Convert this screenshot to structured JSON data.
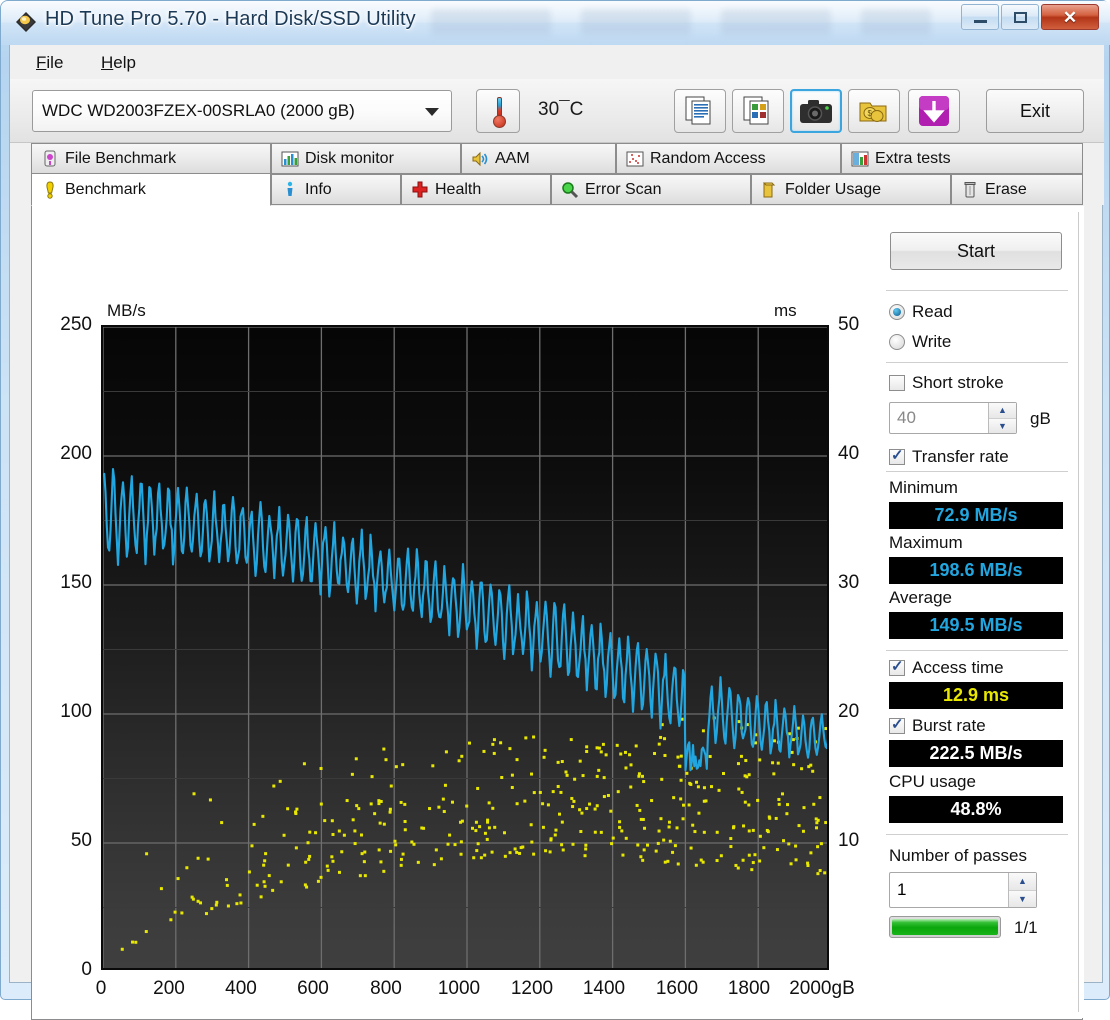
{
  "window": {
    "title": "HD Tune Pro 5.70 - Hard Disk/SSD Utility",
    "app_icon": "hdtune-diamond-icon",
    "minimize_label": "",
    "maximize_label": "",
    "close_label": "✕"
  },
  "menubar": {
    "items": [
      {
        "label": "File",
        "mnemonic": "F"
      },
      {
        "label": "Help",
        "mnemonic": "H"
      }
    ]
  },
  "toolbar": {
    "drive": {
      "selected": "WDC WD2003FZEX-00SRLA0 (2000 gB)",
      "options": [
        "WDC WD2003FZEX-00SRLA0 (2000 gB)"
      ]
    },
    "temperature": "30¯C",
    "temperature_icon": "thermometer-icon",
    "buttons": [
      {
        "name": "copy-text-button",
        "icon": "copy-text-icon",
        "focused": false
      },
      {
        "name": "copy-image-button",
        "icon": "copy-image-icon",
        "focused": false
      },
      {
        "name": "screenshot-button",
        "icon": "camera-icon",
        "focused": true
      },
      {
        "name": "save-button",
        "icon": "folder-coins-icon",
        "focused": false
      },
      {
        "name": "download-button",
        "icon": "purple-download-icon",
        "focused": false
      }
    ],
    "exit_label": "Exit"
  },
  "tabs": {
    "top_row": [
      {
        "label": "File Benchmark",
        "icon": "flask-icon",
        "active": false
      },
      {
        "label": "Disk monitor",
        "icon": "bar-chart-icon",
        "active": false
      },
      {
        "label": "AAM",
        "icon": "speaker-icon",
        "active": false
      },
      {
        "label": "Random Access",
        "icon": "scatter-icon",
        "active": false
      },
      {
        "label": "Extra tests",
        "icon": "chart-grid-icon",
        "active": false
      }
    ],
    "bottom_row": [
      {
        "label": "Benchmark",
        "icon": "exclamation-icon",
        "active": true
      },
      {
        "label": "Info",
        "icon": "info-icon",
        "active": false
      },
      {
        "label": "Health",
        "icon": "red-cross-icon",
        "active": false
      },
      {
        "label": "Error Scan",
        "icon": "magnifier-icon",
        "active": false
      },
      {
        "label": "Folder Usage",
        "icon": "folder-icon",
        "active": false
      },
      {
        "label": "Erase",
        "icon": "trash-icon",
        "active": false
      }
    ]
  },
  "panel": {
    "start_label": "Start",
    "mode": {
      "read_label": "Read",
      "write_label": "Write",
      "selected": "Read"
    },
    "short_stroke": {
      "label": "Short stroke",
      "checked": false,
      "value": "40",
      "unit": "gB"
    },
    "transfer_rate": {
      "label": "Transfer rate",
      "checked": true
    },
    "results": [
      {
        "label": "Minimum",
        "value": "72.9 MB/s",
        "color": "#22a6e0"
      },
      {
        "label": "Maximum",
        "value": "198.6 MB/s",
        "color": "#22a6e0"
      },
      {
        "label": "Average",
        "value": "149.5 MB/s",
        "color": "#22a6e0"
      }
    ],
    "access_time": {
      "label": "Access time",
      "checked": true,
      "value": "12.9 ms",
      "color": "#e8e800"
    },
    "burst_rate": {
      "label": "Burst rate",
      "checked": true,
      "value": "222.5 MB/s",
      "color": "#ffffff"
    },
    "cpu_usage": {
      "label": "CPU usage",
      "value": "48.8%",
      "color": "#ffffff"
    },
    "passes": {
      "label": "Number of passes",
      "value": "1"
    },
    "progress": {
      "percent": 100,
      "text": "1/1"
    }
  },
  "chart_data": {
    "type": "line",
    "title": "",
    "xlabel": "2000gB",
    "ylabel": "MB/s",
    "y2label": "ms",
    "xlim": [
      0,
      2000
    ],
    "ylim": [
      0,
      250
    ],
    "y2lim": [
      0,
      50
    ],
    "grid": true,
    "legend": "none",
    "xticks": [
      0,
      200,
      400,
      600,
      800,
      1000,
      1200,
      1400,
      1600,
      1800,
      2000
    ],
    "xtick_labels": [
      "0",
      "200",
      "400",
      "600",
      "800",
      "1000",
      "1200",
      "1400",
      "1600",
      "1800",
      "2000gB"
    ],
    "yticks": [
      0,
      50,
      100,
      150,
      200,
      250
    ],
    "ytick_labels": [
      "0",
      "50",
      "100",
      "150",
      "200",
      "250"
    ],
    "y2ticks": [
      10,
      20,
      30,
      40,
      50
    ],
    "y2tick_labels": [
      "10",
      "20",
      "30",
      "40",
      "50"
    ],
    "series": [
      {
        "name": "Transfer rate",
        "type": "line",
        "color": "#22a6e0",
        "axis": "left",
        "unit": "MB/s",
        "envelope_note": "dense sawtooth oscillation between a falling upper and lower bound",
        "upper": [
          [
            0,
            198.6
          ],
          [
            40,
            196
          ],
          [
            80,
            194
          ],
          [
            120,
            193
          ],
          [
            160,
            192
          ],
          [
            200,
            190
          ],
          [
            240,
            189
          ],
          [
            280,
            187
          ],
          [
            320,
            186
          ],
          [
            360,
            185
          ],
          [
            400,
            184
          ],
          [
            440,
            182
          ],
          [
            480,
            181
          ],
          [
            520,
            179
          ],
          [
            560,
            178
          ],
          [
            600,
            176
          ],
          [
            640,
            175
          ],
          [
            680,
            173
          ],
          [
            720,
            171
          ],
          [
            760,
            169
          ],
          [
            800,
            167
          ],
          [
            840,
            165
          ],
          [
            880,
            163
          ],
          [
            920,
            161
          ],
          [
            960,
            159
          ],
          [
            1000,
            157
          ],
          [
            1040,
            155
          ],
          [
            1080,
            153
          ],
          [
            1120,
            151
          ],
          [
            1160,
            149
          ],
          [
            1200,
            147
          ],
          [
            1240,
            145
          ],
          [
            1280,
            142
          ],
          [
            1320,
            140
          ],
          [
            1360,
            137
          ],
          [
            1400,
            135
          ],
          [
            1440,
            132
          ],
          [
            1480,
            129
          ],
          [
            1520,
            127
          ],
          [
            1560,
            124
          ],
          [
            1600,
            121
          ],
          [
            1640,
            118
          ],
          [
            1680,
            115
          ],
          [
            1720,
            112
          ],
          [
            1760,
            110
          ],
          [
            1800,
            108
          ],
          [
            1840,
            106
          ],
          [
            1880,
            104
          ],
          [
            1920,
            102
          ],
          [
            1960,
            100
          ],
          [
            2000,
            99
          ]
        ],
        "lower": [
          [
            0,
            160
          ],
          [
            40,
            158
          ],
          [
            80,
            161
          ],
          [
            120,
            159
          ],
          [
            160,
            160
          ],
          [
            200,
            158
          ],
          [
            240,
            157
          ],
          [
            280,
            157
          ],
          [
            320,
            156
          ],
          [
            360,
            155
          ],
          [
            400,
            154
          ],
          [
            440,
            152
          ],
          [
            480,
            151
          ],
          [
            520,
            149
          ],
          [
            560,
            148
          ],
          [
            600,
            146
          ],
          [
            640,
            145
          ],
          [
            680,
            143
          ],
          [
            720,
            141
          ],
          [
            760,
            139
          ],
          [
            800,
            137
          ],
          [
            840,
            135
          ],
          [
            880,
            133
          ],
          [
            920,
            131
          ],
          [
            960,
            129
          ],
          [
            1000,
            127
          ],
          [
            1040,
            125
          ],
          [
            1080,
            123
          ],
          [
            1120,
            121
          ],
          [
            1160,
            119
          ],
          [
            1200,
            117
          ],
          [
            1240,
            114
          ],
          [
            1280,
            111
          ],
          [
            1320,
            109
          ],
          [
            1360,
            106
          ],
          [
            1400,
            104
          ],
          [
            1440,
            101
          ],
          [
            1480,
            98
          ],
          [
            1520,
            96
          ],
          [
            1560,
            93
          ],
          [
            1600,
            90
          ],
          [
            1640,
            73
          ],
          [
            1680,
            88
          ],
          [
            1720,
            86
          ],
          [
            1760,
            85
          ],
          [
            1800,
            84
          ],
          [
            1840,
            83
          ],
          [
            1880,
            82
          ],
          [
            1920,
            81
          ],
          [
            1960,
            80
          ],
          [
            2000,
            86
          ]
        ],
        "minimum": 72.9,
        "maximum": 198.6,
        "average": 149.5
      },
      {
        "name": "Access time",
        "type": "scatter",
        "color": "#e8e800",
        "axis": "left",
        "unit": "ms (plotted on left scale as MB/s-equivalent)",
        "trend_note": "cloud of points rising from ~20 at x=0 to ~85 near x=1200, tapering after",
        "band_lower": [
          [
            0,
            5
          ],
          [
            200,
            18
          ],
          [
            400,
            28
          ],
          [
            600,
            35
          ],
          [
            800,
            40
          ],
          [
            1000,
            44
          ],
          [
            1200,
            46
          ],
          [
            1400,
            45
          ],
          [
            1600,
            42
          ],
          [
            1800,
            40
          ],
          [
            2000,
            38
          ]
        ],
        "band_upper": [
          [
            0,
            62
          ],
          [
            200,
            70
          ],
          [
            400,
            75
          ],
          [
            600,
            85
          ],
          [
            800,
            88
          ],
          [
            1000,
            90
          ],
          [
            1200,
            92
          ],
          [
            1400,
            90
          ],
          [
            1600,
            100
          ],
          [
            1800,
            98
          ],
          [
            2000,
            95
          ]
        ],
        "value": 12.9
      }
    ]
  }
}
